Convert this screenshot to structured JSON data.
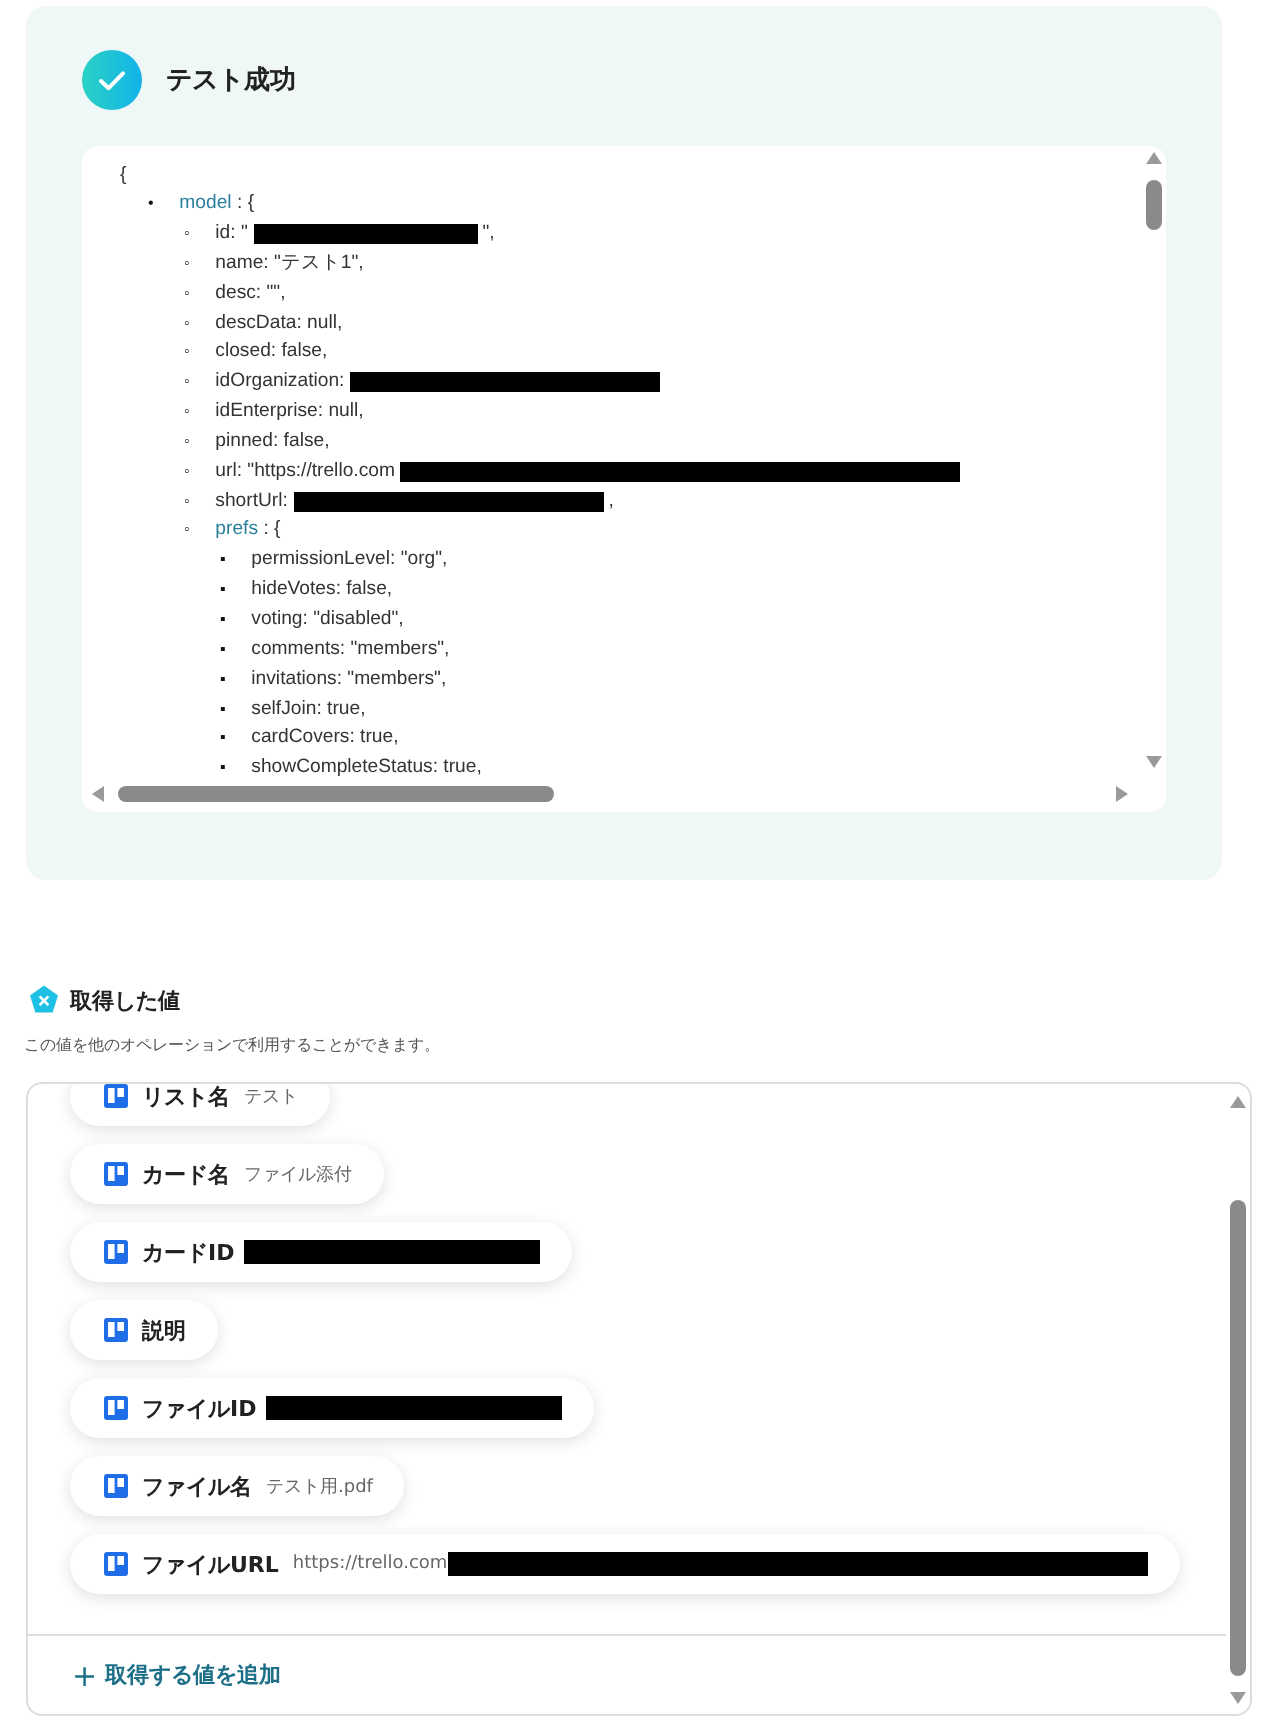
{
  "result": {
    "title": "テスト成功",
    "json_view": {
      "open": "{",
      "items": [
        {
          "marker": "•",
          "key": "model",
          "after": ": {",
          "children": [
            {
              "marker": "◦",
              "text": "id: \"",
              "redacted": true,
              "after": "\","
            },
            {
              "marker": "◦",
              "text": "name: \"テスト1\","
            },
            {
              "marker": "◦",
              "text": "desc: \"\","
            },
            {
              "marker": "◦",
              "text": "descData: null,"
            },
            {
              "marker": "◦",
              "text": "closed: false,"
            },
            {
              "marker": "◦",
              "text": "idOrganization: ",
              "redacted": true
            },
            {
              "marker": "◦",
              "text": "idEnterprise: null,"
            },
            {
              "marker": "◦",
              "text": "pinned: false,"
            },
            {
              "marker": "◦",
              "text": "url: \"https://trello.com",
              "redacted": true
            },
            {
              "marker": "◦",
              "text": "shortUrl: ",
              "redacted": true,
              "after": ","
            },
            {
              "marker": "◦",
              "key": "prefs",
              "after": ": {",
              "children": [
                {
                  "marker": "▪",
                  "text": "permissionLevel: \"org\","
                },
                {
                  "marker": "▪",
                  "text": "hideVotes: false,"
                },
                {
                  "marker": "▪",
                  "text": "voting: \"disabled\","
                },
                {
                  "marker": "▪",
                  "text": "comments: \"members\","
                },
                {
                  "marker": "▪",
                  "text": "invitations: \"members\","
                },
                {
                  "marker": "▪",
                  "text": "selfJoin: true,"
                },
                {
                  "marker": "▪",
                  "text": "cardCovers: true,"
                },
                {
                  "marker": "▪",
                  "text": "showCompleteStatus: true,"
                }
              ]
            }
          ]
        }
      ]
    }
  },
  "values": {
    "title": "取得した値",
    "description": "この値を他のオペレーションで利用することができます。",
    "items": [
      {
        "label": "リスト名",
        "value": "テスト"
      },
      {
        "label": "カード名",
        "value": "ファイル添付"
      },
      {
        "label": "カードID",
        "redacted": true
      },
      {
        "label": "説明"
      },
      {
        "label": "ファイルID",
        "redacted": true
      },
      {
        "label": "ファイル名",
        "value": "テスト用.pdf"
      },
      {
        "label": "ファイルURL",
        "value": "https://trello.com",
        "redacted": true
      }
    ],
    "add_button": {
      "icon": "+",
      "label": "取得する値を追加"
    }
  }
}
